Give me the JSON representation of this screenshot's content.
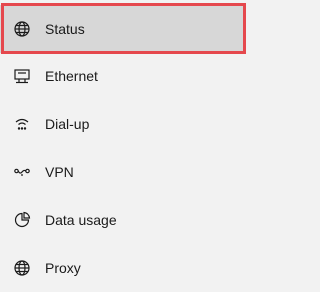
{
  "nav": {
    "selected_index": 0,
    "items": [
      {
        "label": "Status",
        "icon": "globe-status-icon"
      },
      {
        "label": "Ethernet",
        "icon": "ethernet-icon"
      },
      {
        "label": "Dial-up",
        "icon": "dial-up-icon"
      },
      {
        "label": "VPN",
        "icon": "vpn-icon"
      },
      {
        "label": "Data usage",
        "icon": "data-usage-icon"
      },
      {
        "label": "Proxy",
        "icon": "globe-icon"
      }
    ]
  },
  "colors": {
    "background": "#f2f2f2",
    "selected_background": "#d7d7d7",
    "highlight_border": "#e5484d",
    "text": "#1a1a1a"
  }
}
